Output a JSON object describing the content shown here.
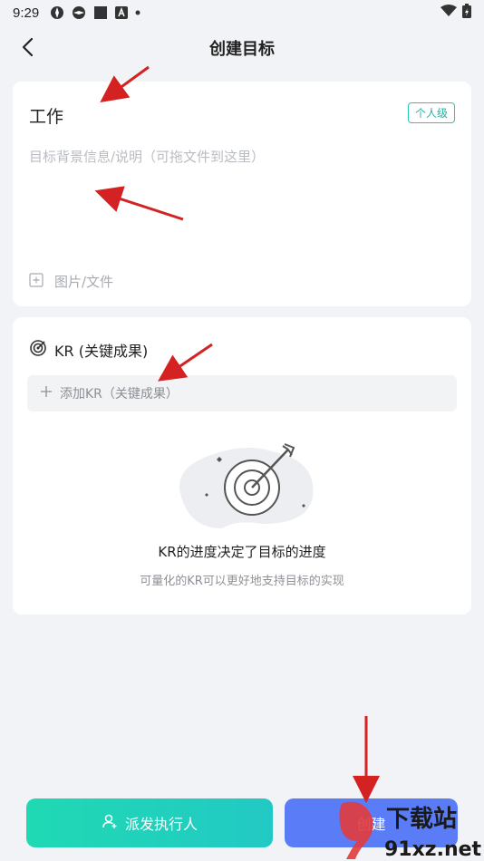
{
  "status_bar": {
    "time": "9:29"
  },
  "header": {
    "title": "创建目标"
  },
  "goal": {
    "title": "工作",
    "level_badge": "个人级",
    "description_placeholder": "目标背景信息/说明（可拖文件到这里）",
    "attach_label": "图片/文件"
  },
  "kr": {
    "heading": "KR (关键成果)",
    "add_label": "添加KR（关键成果）",
    "empty_title": "KR的进度决定了目标的进度",
    "empty_subtitle": "可量化的KR可以更好地支持目标的实现"
  },
  "actions": {
    "assign_label": "派发执行人",
    "create_label": "创建"
  },
  "watermark": {
    "text": "下载站",
    "domain": "91xz.net"
  },
  "colors": {
    "accent_teal": "#22c9c4",
    "create_blue": "#5b7cf7",
    "annotation_red": "#d42222"
  }
}
